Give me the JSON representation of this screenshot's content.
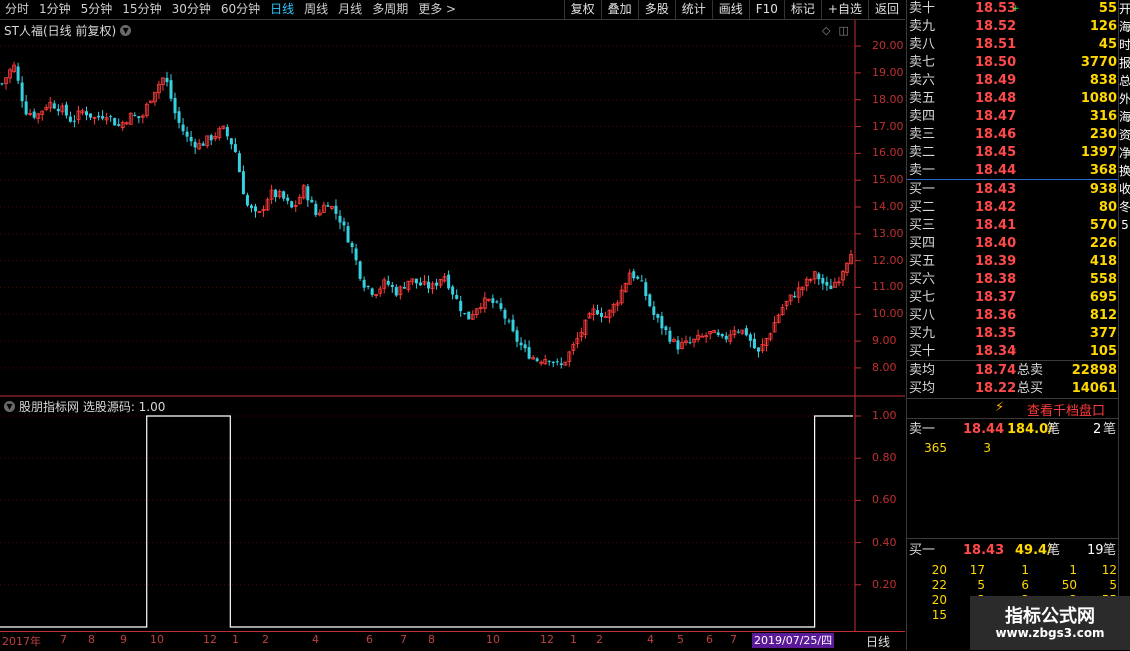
{
  "toolbar": {
    "timeframes": [
      "分时",
      "1分钟",
      "5分钟",
      "15分钟",
      "30分钟",
      "60分钟",
      "日线",
      "周线",
      "月线",
      "多周期",
      "更多 >"
    ],
    "active_index": 6,
    "tools": [
      "复权",
      "叠加",
      "多股",
      "统计",
      "画线",
      "F10",
      "标记",
      "+自选",
      "返回"
    ]
  },
  "chart": {
    "title": "ST人福(日线 前复权)",
    "y_labels": [
      "20.00",
      "19.00",
      "18.00",
      "17.00",
      "16.00",
      "15.00",
      "14.00",
      "13.00",
      "12.00",
      "11.00",
      "10.00",
      "9.00",
      "8.00"
    ],
    "colors": {
      "up": "#ff3c3c",
      "down": "#36d0e0",
      "grid": "#5a0000",
      "axis": "#c03030"
    }
  },
  "indicator": {
    "title": "股朋指标网 选股源码: 1.00",
    "y_labels": [
      "1.00",
      "0.80",
      "0.60",
      "0.40",
      "0.20"
    ]
  },
  "dates": {
    "labels": [
      "2017年",
      "7",
      "8",
      "9",
      "10",
      "12",
      "1",
      "2",
      "4",
      "6",
      "7",
      "8",
      "10",
      "12",
      "1",
      "2",
      "4",
      "5",
      "6",
      "7"
    ],
    "current": "2019/07/25/四",
    "period": "日线"
  },
  "chart_data": {
    "type": "candlestick",
    "title": "ST人福(日线 前复权)",
    "ylim": [
      7.4,
      20.6
    ],
    "close_path": [
      18.6,
      19.3,
      17.6,
      17.4,
      17.9,
      17.7,
      17.2,
      17.6,
      17.3,
      17.5,
      17.0,
      17.4,
      17.3,
      18.3,
      18.9,
      17.3,
      16.5,
      16.3,
      16.6,
      16.9,
      16.2,
      14.1,
      13.6,
      14.5,
      14.4,
      13.9,
      14.7,
      13.7,
      14.2,
      13.6,
      12.6,
      11.2,
      10.8,
      11.2,
      10.8,
      11.3,
      11.1,
      11.0,
      11.5,
      10.6,
      9.8,
      10.4,
      10.5,
      10.1,
      9.2,
      8.6,
      8.3,
      8.4,
      8.0,
      8.7,
      9.5,
      10.2,
      9.9,
      10.6,
      11.6,
      11.1,
      10.0,
      9.4,
      8.8,
      8.9,
      9.1,
      9.3,
      9.0,
      9.5,
      9.3,
      8.5,
      9.3,
      10.2,
      10.7,
      11.1,
      11.5,
      10.9,
      11.4,
      12.4
    ],
    "indicator_segments": [
      {
        "from": 0.0,
        "to": 0.172,
        "value": 0
      },
      {
        "from": 0.172,
        "to": 0.27,
        "value": 1
      },
      {
        "from": 0.27,
        "to": 0.955,
        "value": 0
      },
      {
        "from": 0.955,
        "to": 1.0,
        "value": 1
      }
    ]
  },
  "orderbook": {
    "asks": [
      {
        "label": "卖十",
        "price": "18.53",
        "vol": "55",
        "mark": "+"
      },
      {
        "label": "卖九",
        "price": "18.52",
        "vol": "126",
        "mark": ""
      },
      {
        "label": "卖八",
        "price": "18.51",
        "vol": "45",
        "mark": ""
      },
      {
        "label": "卖七",
        "price": "18.50",
        "vol": "3770",
        "mark": ""
      },
      {
        "label": "卖六",
        "price": "18.49",
        "vol": "838",
        "mark": ""
      },
      {
        "label": "卖五",
        "price": "18.48",
        "vol": "1080",
        "mark": ""
      },
      {
        "label": "卖四",
        "price": "18.47",
        "vol": "316",
        "mark": ""
      },
      {
        "label": "卖三",
        "price": "18.46",
        "vol": "230",
        "mark": ""
      },
      {
        "label": "卖二",
        "price": "18.45",
        "vol": "1397",
        "mark": ""
      },
      {
        "label": "卖一",
        "price": "18.44",
        "vol": "368",
        "mark": ""
      }
    ],
    "bids": [
      {
        "label": "买一",
        "price": "18.43",
        "vol": "938",
        "mark": ""
      },
      {
        "label": "买二",
        "price": "18.42",
        "vol": "80",
        "mark": ""
      },
      {
        "label": "买三",
        "price": "18.41",
        "vol": "570",
        "mark": ""
      },
      {
        "label": "买四",
        "price": "18.40",
        "vol": "226",
        "mark": ""
      },
      {
        "label": "买五",
        "price": "18.39",
        "vol": "418",
        "mark": ""
      },
      {
        "label": "买六",
        "price": "18.38",
        "vol": "558",
        "mark": ""
      },
      {
        "label": "买七",
        "price": "18.37",
        "vol": "695",
        "mark": ""
      },
      {
        "label": "买八",
        "price": "18.36",
        "vol": "812",
        "mark": ""
      },
      {
        "label": "买九",
        "price": "18.35",
        "vol": "377",
        "mark": ""
      },
      {
        "label": "买十",
        "price": "18.34",
        "vol": "105",
        "mark": "*"
      }
    ],
    "ask_avg": {
      "label": "卖均",
      "price": "18.74",
      "tlabel": "总卖",
      "total": "22898"
    },
    "bid_avg": {
      "label": "买均",
      "price": "18.22",
      "tlabel": "总买",
      "total": "14061"
    },
    "depth_button": "查看千档盘口",
    "bolt_icon": "⚡",
    "queue_sell": {
      "label": "卖一",
      "price": "18.44",
      "avg": "184.0/",
      "unit": "笔",
      "count": "2",
      "unit2": "笔"
    },
    "queue_sell_orders": [
      "365",
      "3"
    ],
    "queue_buy": {
      "label": "买一",
      "price": "18.43",
      "avg": "49.4/",
      "unit": "笔",
      "count": "19",
      "unit2": "笔"
    },
    "queue_buy_orders": [
      [
        "20",
        "17",
        "1",
        "1",
        "12"
      ],
      [
        "22",
        "5",
        "6",
        "50",
        "5"
      ],
      [
        "20",
        "3",
        "3",
        "3",
        "55"
      ],
      [
        "15",
        "",
        "",
        "",
        ""
      ]
    ]
  },
  "right_strip": [
    "开",
    "海",
    "时",
    "报",
    "总",
    "外",
    "",
    "",
    "",
    "海",
    "资",
    "净",
    "换",
    "收",
    "冬",
    "5"
  ],
  "watermark": {
    "line1": "指标公式网",
    "line2": "www.zbgs3.com"
  }
}
